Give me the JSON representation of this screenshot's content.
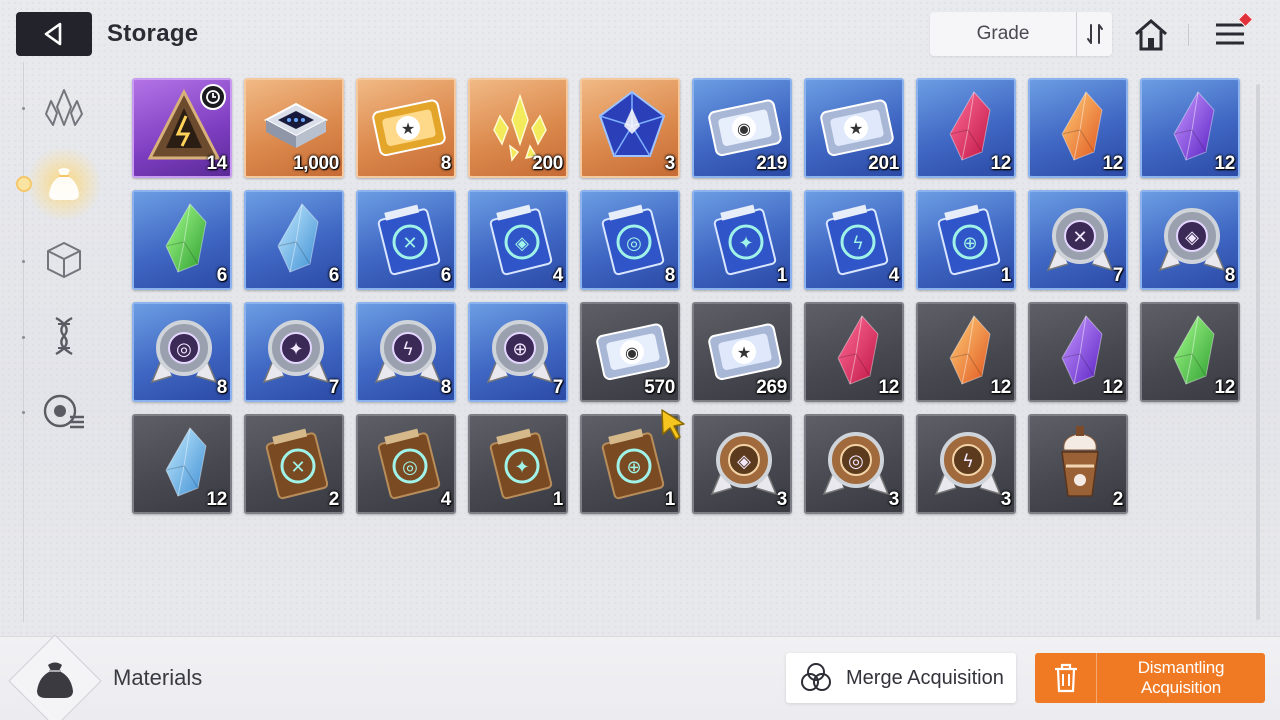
{
  "header": {
    "title": "Storage",
    "back_icon": "back-arrow-icon",
    "sort_label": "Grade",
    "sort_icon": "sort-order-icon",
    "home_icon": "home-icon",
    "menu_icon": "hamburger-menu-icon",
    "notification": "red-diamond-dot"
  },
  "sidebar": {
    "tabs": [
      {
        "icon": "crystal-cluster-icon",
        "active": false
      },
      {
        "icon": "material-bag-icon",
        "active": true
      },
      {
        "icon": "cube-icon",
        "active": false
      },
      {
        "icon": "dna-helix-icon",
        "active": false
      },
      {
        "icon": "target-list-icon",
        "active": false
      }
    ]
  },
  "items": [
    {
      "grade": "purple",
      "icon": "pyramid-core-icon",
      "qty": "14",
      "timed": true
    },
    {
      "grade": "orange",
      "icon": "memory-chip-icon",
      "qty": "1,000"
    },
    {
      "grade": "orange",
      "icon": "gold-ticket-icon",
      "qty": "8"
    },
    {
      "grade": "orange",
      "icon": "yellow-shards-icon",
      "qty": "200"
    },
    {
      "grade": "orange",
      "icon": "blue-prism-icon",
      "qty": "3"
    },
    {
      "grade": "blue",
      "icon": "profile-ticket-icon",
      "qty": "219"
    },
    {
      "grade": "blue",
      "icon": "star-ticket-icon",
      "qty": "201"
    },
    {
      "grade": "blue",
      "icon": "red-crystal-icon",
      "qty": "12"
    },
    {
      "grade": "blue",
      "icon": "orange-crystal-icon",
      "qty": "12"
    },
    {
      "grade": "blue",
      "icon": "purple-crystal-icon",
      "qty": "12"
    },
    {
      "grade": "blue",
      "icon": "green-crystal-icon",
      "qty": "6"
    },
    {
      "grade": "blue",
      "icon": "cyan-crystal-icon",
      "qty": "6"
    },
    {
      "grade": "blue",
      "icon": "swords-manual-icon",
      "qty": "6"
    },
    {
      "grade": "blue",
      "icon": "shield-manual-icon",
      "qty": "4"
    },
    {
      "grade": "blue",
      "icon": "eye-manual-icon",
      "qty": "8"
    },
    {
      "grade": "blue",
      "icon": "wing-manual-icon",
      "qty": "1"
    },
    {
      "grade": "blue",
      "icon": "bolt-manual-icon",
      "qty": "4"
    },
    {
      "grade": "blue",
      "icon": "orb-manual-icon",
      "qty": "1"
    },
    {
      "grade": "blue",
      "icon": "swords-medal-icon",
      "qty": "7"
    },
    {
      "grade": "blue",
      "icon": "shield-medal-icon",
      "qty": "8"
    },
    {
      "grade": "blue",
      "icon": "eye-medal-icon",
      "qty": "8"
    },
    {
      "grade": "blue",
      "icon": "wing-medal-icon",
      "qty": "7"
    },
    {
      "grade": "blue",
      "icon": "bolt-medal-icon",
      "qty": "8"
    },
    {
      "grade": "blue",
      "icon": "orb-medal-icon",
      "qty": "7"
    },
    {
      "grade": "gray",
      "icon": "profile-ticket-icon",
      "qty": "570"
    },
    {
      "grade": "gray",
      "icon": "star-ticket-icon",
      "qty": "269"
    },
    {
      "grade": "gray",
      "icon": "red-crystal-icon",
      "qty": "12"
    },
    {
      "grade": "gray",
      "icon": "orange-crystal-icon",
      "qty": "12"
    },
    {
      "grade": "gray",
      "icon": "purple-crystal-icon",
      "qty": "12"
    },
    {
      "grade": "gray",
      "icon": "green-crystal-icon",
      "qty": "12"
    },
    {
      "grade": "gray",
      "icon": "cyan-crystal-icon",
      "qty": "12"
    },
    {
      "grade": "gray",
      "icon": "swords-manual-icon",
      "qty": "2"
    },
    {
      "grade": "gray",
      "icon": "eye-manual-icon",
      "qty": "4"
    },
    {
      "grade": "gray",
      "icon": "wing-manual-icon",
      "qty": "1"
    },
    {
      "grade": "gray",
      "icon": "orb-manual-icon",
      "qty": "1"
    },
    {
      "grade": "gray",
      "icon": "shield-medal-icon",
      "qty": "3"
    },
    {
      "grade": "gray",
      "icon": "eye-medal-icon",
      "qty": "3"
    },
    {
      "grade": "gray",
      "icon": "bolt-medal-icon",
      "qty": "3"
    },
    {
      "grade": "gray",
      "icon": "frappe-drink-icon",
      "qty": "2"
    }
  ],
  "footer": {
    "category_label": "Materials",
    "category_icon": "material-bag-icon",
    "merge_label": "Merge Acquisition",
    "merge_icon": "merge-circles-icon",
    "dismantle_label": "Dismantling Acquisition",
    "dismantle_icon": "trash-can-icon"
  },
  "colors": {
    "accent_orange": "#f07a23",
    "grade_purple": "#7d3dc0",
    "grade_orange": "#dc8a4d",
    "grade_blue": "#3f67c3",
    "grade_gray": "#46474f"
  }
}
